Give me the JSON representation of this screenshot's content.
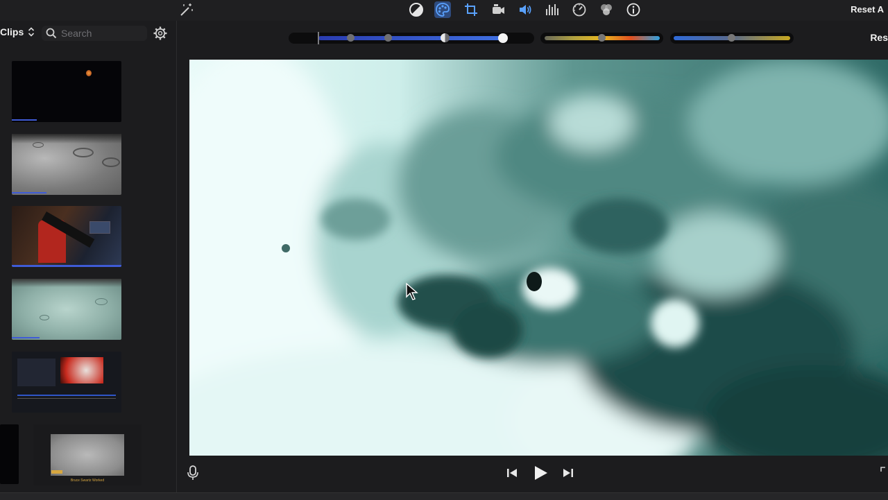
{
  "toolbar": {
    "icons": [
      "magic-wand-icon",
      "color-balance-icon",
      "color-correction-icon",
      "crop-icon",
      "stabilization-icon",
      "volume-icon",
      "equalizer-icon",
      "speed-icon",
      "clip-filter-icon",
      "info-icon"
    ],
    "active_icon": "color-correction-icon",
    "reset_label": "Reset A"
  },
  "browser": {
    "clips_label": "Clips",
    "search_placeholder": "Search",
    "clips": [
      {
        "name": "orange-planet-clip"
      },
      {
        "name": "moon-craters-clip"
      },
      {
        "name": "telescope-room-clip"
      },
      {
        "name": "moon-teal-clip"
      },
      {
        "name": "editor-screenshot-clip"
      },
      {
        "name": "gray-moon-title-clip"
      }
    ],
    "last_clip_caption": "Bruce Swartz Worked"
  },
  "color_adjust": {
    "reset_label": "Res",
    "exposure_levels": [
      0.07,
      0.23,
      0.52
    ],
    "brightness": 0.69,
    "contrast": 0.89,
    "saturation": 0.5,
    "temperature": 0.5
  },
  "colors": {
    "accent": "#3f6fe0",
    "active_icon_bg": "#2f4c7f",
    "panel": "#1c1c1e"
  },
  "viewer": {
    "content": "moon-surface-teal"
  },
  "transport": {
    "icons": [
      "voiceover-mic-icon",
      "skip-back-icon",
      "play-icon",
      "skip-forward-icon"
    ]
  }
}
